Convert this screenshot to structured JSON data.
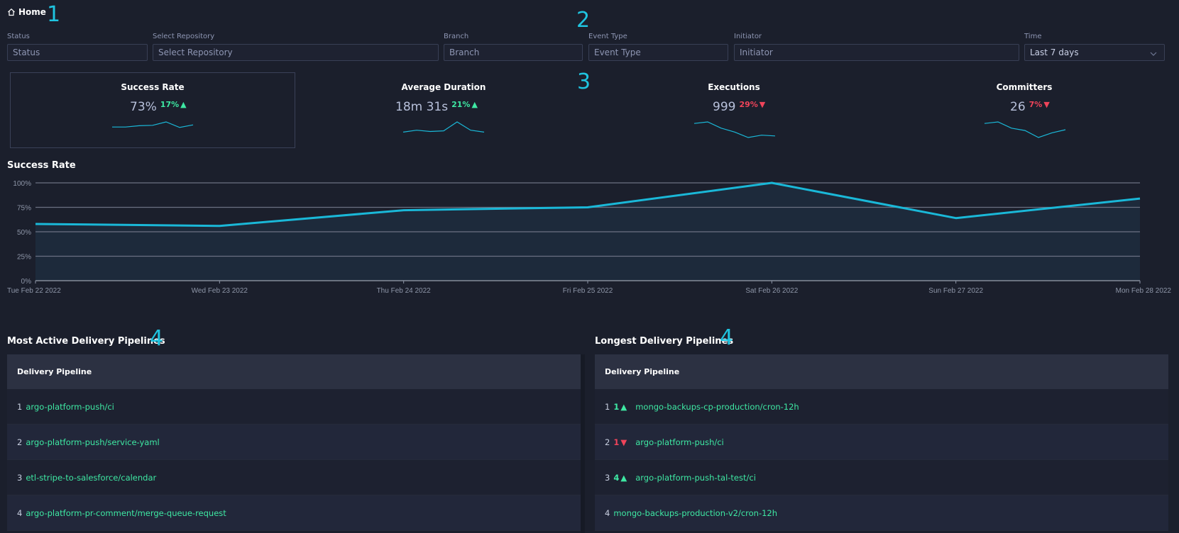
{
  "annotations": {
    "a1": "1",
    "a2": "2",
    "a3": "3",
    "a4a": "4",
    "a4b": "4"
  },
  "header": {
    "home_label": "Home"
  },
  "filters": {
    "status": {
      "label": "Status",
      "placeholder": "Status"
    },
    "repository": {
      "label": "Select Repository",
      "placeholder": "Select Repository"
    },
    "branch": {
      "label": "Branch",
      "placeholder": "Branch"
    },
    "event_type": {
      "label": "Event Type",
      "placeholder": "Event Type"
    },
    "initiator": {
      "label": "Initiator",
      "placeholder": "Initiator"
    },
    "time": {
      "label": "Time",
      "value": "Last 7 days"
    }
  },
  "kpis": [
    {
      "title": "Success Rate",
      "value": "73%",
      "delta": "17%",
      "direction": "up",
      "spark": [
        0.4,
        0.4,
        0.55,
        0.6,
        1.0,
        0.35,
        0.65
      ]
    },
    {
      "title": "Average Duration",
      "value": "18m 31s",
      "delta": "21%",
      "direction": "up",
      "spark": [
        0.2,
        0.35,
        0.25,
        0.3,
        1.0,
        0.35,
        0.2
      ]
    },
    {
      "title": "Executions",
      "value": "999",
      "delta": "29%",
      "direction": "down",
      "spark": [
        0.9,
        1.0,
        0.6,
        0.35,
        0.0,
        0.15,
        0.1
      ]
    },
    {
      "title": "Committers",
      "value": "26",
      "delta": "7%",
      "direction": "down",
      "spark": [
        0.9,
        1.0,
        0.6,
        0.45,
        0.0,
        0.3,
        0.5
      ]
    }
  ],
  "chart_title": "Success Rate",
  "chart_data": {
    "type": "area",
    "title": "Success Rate",
    "categories": [
      "Tue Feb 22 2022",
      "Wed Feb 23 2022",
      "Thu Feb 24 2022",
      "Fri Feb 25 2022",
      "Sat Feb 26 2022",
      "Sun Feb 27 2022",
      "Mon Feb 28 2022"
    ],
    "series": [
      {
        "values": [
          58,
          56,
          72,
          75,
          100,
          64,
          84
        ]
      }
    ],
    "y_ticks": [
      "100%",
      "75%",
      "50%",
      "25%",
      "0%"
    ],
    "ylim": [
      0,
      100
    ],
    "grid": true,
    "color": "#1ab8d8"
  },
  "most_active": {
    "title": "Most Active Delivery Pipelines",
    "column": "Delivery Pipeline",
    "rows": [
      {
        "rank": "1",
        "name": "argo-platform-push/ci"
      },
      {
        "rank": "2",
        "name": "argo-platform-push/service-yaml"
      },
      {
        "rank": "3",
        "name": "etl-stripe-to-salesforce/calendar"
      },
      {
        "rank": "4",
        "name": "argo-platform-pr-comment/merge-queue-request"
      }
    ]
  },
  "longest": {
    "title": "Longest Delivery Pipelines",
    "column": "Delivery Pipeline",
    "rows": [
      {
        "rank": "1",
        "move": "1",
        "direction": "up",
        "name": "mongo-backups-cp-production/cron-12h"
      },
      {
        "rank": "2",
        "move": "1",
        "direction": "down",
        "name": "argo-platform-push/ci"
      },
      {
        "rank": "3",
        "move": "4",
        "direction": "up",
        "name": "argo-platform-push-tal-test/ci"
      },
      {
        "rank": "4",
        "move": "",
        "direction": "",
        "name": "mongo-backups-production-v2/cron-12h"
      }
    ]
  },
  "colors": {
    "accent": "#1ab8d8",
    "up": "#3ee8a3",
    "down": "#f0445a",
    "link": "#3ee8a3"
  }
}
